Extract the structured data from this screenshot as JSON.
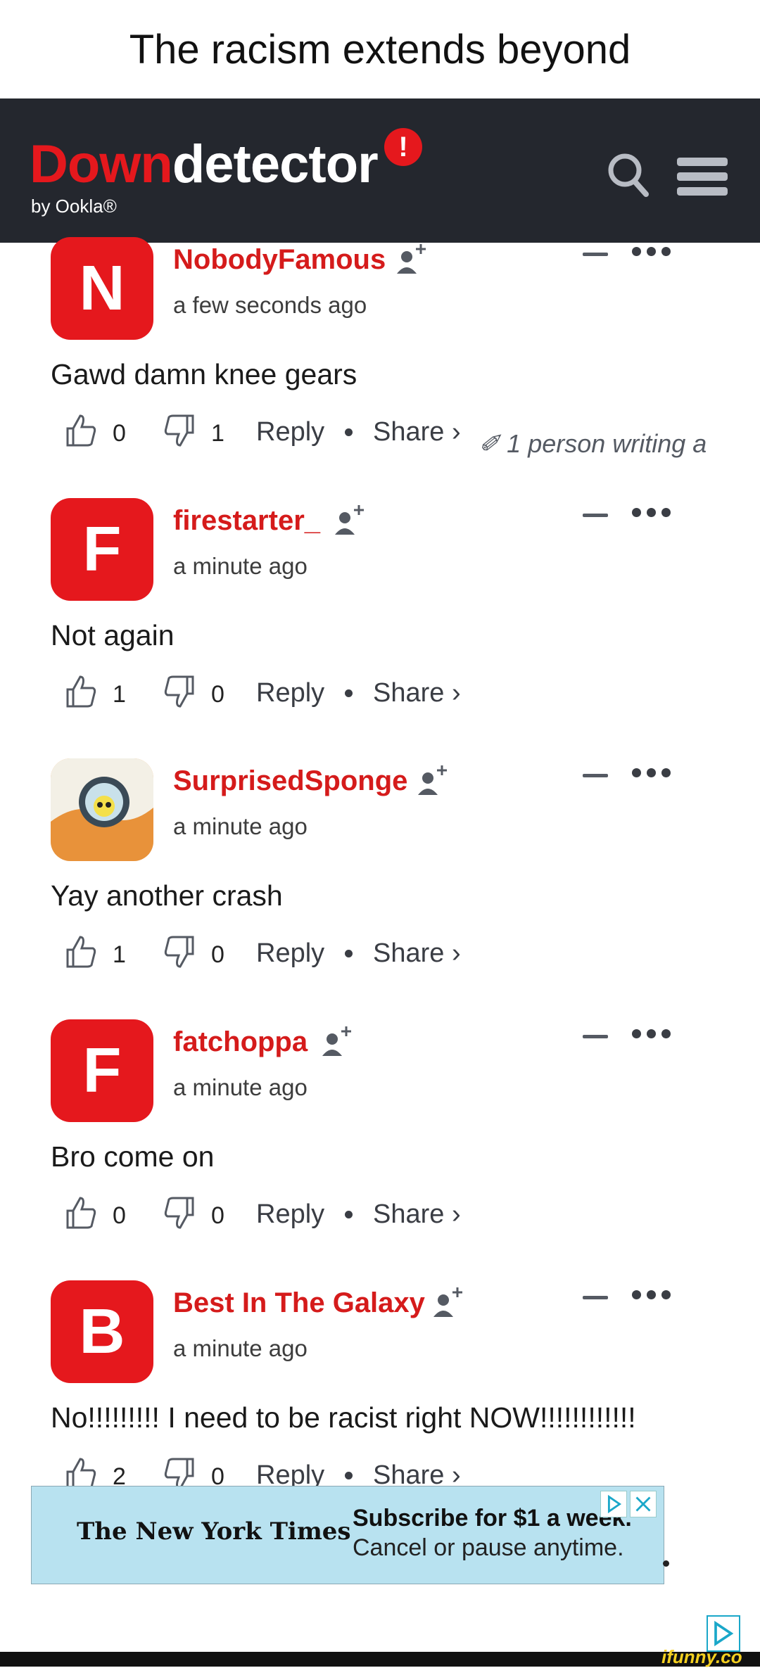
{
  "caption": "The racism extends beyond",
  "header": {
    "logo_down": "Down",
    "logo_detector": "detector",
    "logo_bang": "!",
    "byline": "by Ookla®"
  },
  "comments": [
    {
      "avatar_letter": "N",
      "username": "NobodyFamous",
      "time": "a few seconds ago",
      "text": "Gawd damn knee gears",
      "likes": "0",
      "dislikes": "1",
      "reply": "Reply",
      "share": "Share ›"
    },
    {
      "avatar_letter": "F",
      "username": "firestarter_",
      "time": "a minute ago",
      "text": "Not again",
      "likes": "1",
      "dislikes": "0",
      "reply": "Reply",
      "share": "Share ›"
    },
    {
      "avatar_letter": "",
      "username": "SurprisedSponge",
      "time": "a minute ago",
      "text": "Yay another crash",
      "likes": "1",
      "dislikes": "0",
      "reply": "Reply",
      "share": "Share ›"
    },
    {
      "avatar_letter": "F",
      "username": "fatchoppa",
      "time": "a minute ago",
      "text": "Bro come on",
      "likes": "0",
      "dislikes": "0",
      "reply": "Reply",
      "share": "Share ›"
    },
    {
      "avatar_letter": "B",
      "username": "Best In The Galaxy",
      "time": "a minute ago",
      "text": "No!!!!!!!!! I need to be racist right NOW!!!!!!!!!!!!",
      "likes": "2",
      "dislikes": "0",
      "reply": "Reply",
      "share": "Share ›"
    }
  ],
  "writing_indicator": "1 person writing a",
  "ad": {
    "brand": "The New York Times",
    "headline": "Subscribe for $1 a week.",
    "subline": "Cancel or pause anytime."
  },
  "watermark": "ifunny.co",
  "colors": {
    "brand_red": "#e5181d",
    "header_bg": "#24272e",
    "ad_bg": "#b8e2f0"
  }
}
